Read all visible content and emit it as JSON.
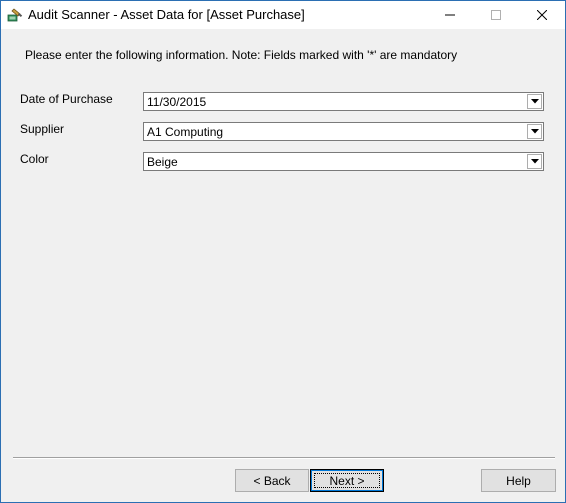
{
  "window": {
    "title": "Audit Scanner - Asset Data for [Asset Purchase]",
    "app_icon": "audit-scanner-icon",
    "controls": {
      "minimize": "minimize-icon",
      "maximize": "maximize-icon",
      "close": "close-icon"
    }
  },
  "form": {
    "instructions": "Please enter the following information. Note: Fields marked with '*' are mandatory",
    "fields": [
      {
        "label": "Date of Purchase",
        "value": "11/30/2015"
      },
      {
        "label": "Supplier",
        "value": "A1 Computing"
      },
      {
        "label": "Color",
        "value": "Beige"
      }
    ]
  },
  "buttons": {
    "back": "< Back",
    "next": "Next >",
    "help": "Help"
  }
}
